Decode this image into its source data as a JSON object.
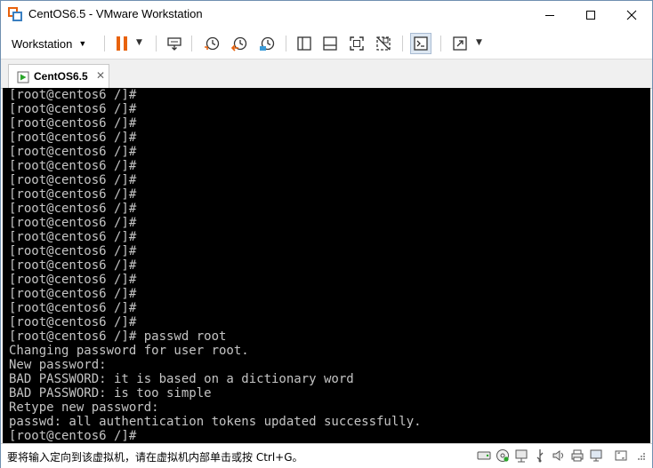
{
  "window": {
    "title": "CentOS6.5 - VMware Workstation"
  },
  "toolbar": {
    "menu_label": "Workstation",
    "buttons": [
      "pause-icon",
      "send-ctrl-alt-del-icon",
      "snapshot-icon",
      "revert-snapshot-icon",
      "snapshot-manager-icon",
      "sidebar-icon",
      "thumbnail-icon",
      "fullscreen-icon",
      "unity-icon",
      "console-view-icon",
      "stretch-icon"
    ]
  },
  "tabs": [
    {
      "label": "CentOS6.5",
      "active": true
    }
  ],
  "console": {
    "lines": [
      "[root@centos6 /]#",
      "[root@centos6 /]#",
      "[root@centos6 /]#",
      "[root@centos6 /]#",
      "[root@centos6 /]#",
      "[root@centos6 /]#",
      "[root@centos6 /]#",
      "[root@centos6 /]#",
      "[root@centos6 /]#",
      "[root@centos6 /]#",
      "[root@centos6 /]#",
      "[root@centos6 /]#",
      "[root@centos6 /]#",
      "[root@centos6 /]#",
      "[root@centos6 /]#",
      "[root@centos6 /]#",
      "[root@centos6 /]#",
      "[root@centos6 /]# passwd root",
      "Changing password for user root.",
      "New password:",
      "BAD PASSWORD: it is based on a dictionary word",
      "BAD PASSWORD: is too simple",
      "Retype new password:",
      "passwd: all authentication tokens updated successfully.",
      "[root@centos6 /]#"
    ]
  },
  "statusbar": {
    "message": "要将输入定向到该虚拟机，请在虚拟机内部单击或按 Ctrl+G。",
    "icons": [
      "hard-disk-icon",
      "cd-dvd-icon",
      "network-icon",
      "usb-icon",
      "sound-icon",
      "printer-icon",
      "display-icon",
      "fullscreen-toggle-icon"
    ]
  },
  "colors": {
    "accent": "#e8620c",
    "console_bg": "#000000",
    "console_fg": "#c4c4c4"
  }
}
